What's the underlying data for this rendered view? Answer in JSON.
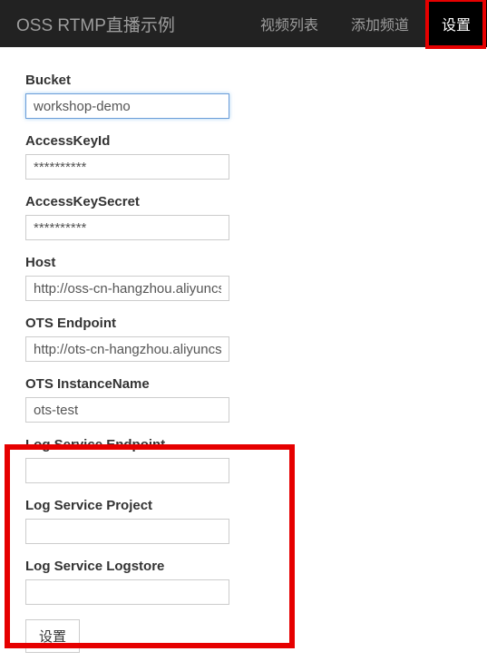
{
  "navbar": {
    "brand": "OSS RTMP直播示例",
    "items": [
      {
        "label": "视频列表",
        "active": false
      },
      {
        "label": "添加频道",
        "active": false
      },
      {
        "label": "设置",
        "active": true
      }
    ]
  },
  "form": {
    "bucket": {
      "label": "Bucket",
      "value": "workshop-demo"
    },
    "accessKeyId": {
      "label": "AccessKeyId",
      "value": "**********"
    },
    "accessKeySecret": {
      "label": "AccessKeySecret",
      "value": "**********"
    },
    "host": {
      "label": "Host",
      "value": "http://oss-cn-hangzhou.aliyuncs.com"
    },
    "otsEndpoint": {
      "label": "OTS Endpoint",
      "value": "http://ots-cn-hangzhou.aliyuncs.com"
    },
    "otsInstanceName": {
      "label": "OTS InstanceName",
      "value": "ots-test"
    },
    "logServiceEndpoint": {
      "label": "Log Service Endpoint",
      "value": ""
    },
    "logServiceProject": {
      "label": "Log Service Project",
      "value": ""
    },
    "logServiceLogstore": {
      "label": "Log Service Logstore",
      "value": ""
    },
    "submitLabel": "设置"
  }
}
